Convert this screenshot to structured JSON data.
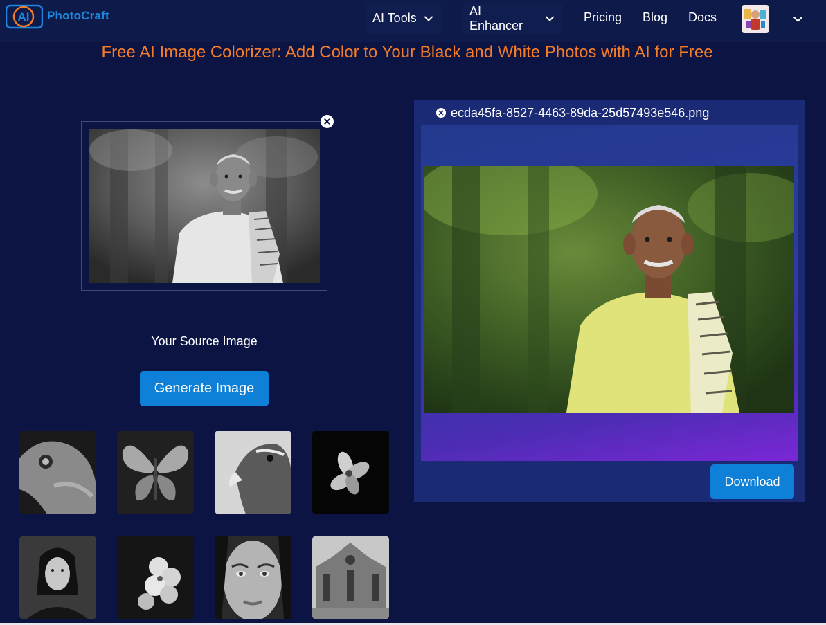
{
  "nav": {
    "logo_badge": "AI",
    "logo_text": "PhotoCraft",
    "ai_tools_label": "AI Tools",
    "ai_enhancer_label": "AI Enhancer",
    "pricing_label": "Pricing",
    "blog_label": "Blog",
    "docs_label": "Docs"
  },
  "page": {
    "title": "Free AI Image Colorizer: Add Color to Your Black and White Photos with AI for Free"
  },
  "source": {
    "caption": "Your Source Image",
    "generate_label": "Generate Image"
  },
  "result": {
    "file_name": "ecda45fa-8527-4463-89da-25d57493e546.png",
    "download_label": "Download"
  },
  "samples": [
    {
      "subject": "lizard"
    },
    {
      "subject": "butterfly"
    },
    {
      "subject": "eagle"
    },
    {
      "subject": "flower"
    },
    {
      "subject": "woman-portrait"
    },
    {
      "subject": "flowers"
    },
    {
      "subject": "face-closeup"
    },
    {
      "subject": "cathedral"
    }
  ],
  "colors": {
    "background": "#0b1442",
    "navbar": "#0d1a4a",
    "title_orange": "#f57c28",
    "button_blue": "#0f80d8",
    "result_panel": "#1b2a75"
  },
  "icons": {
    "nav_dropdown": "chevron-down-icon",
    "remove_image": "close-circle-icon",
    "user_menu": "chevron-down-icon"
  }
}
